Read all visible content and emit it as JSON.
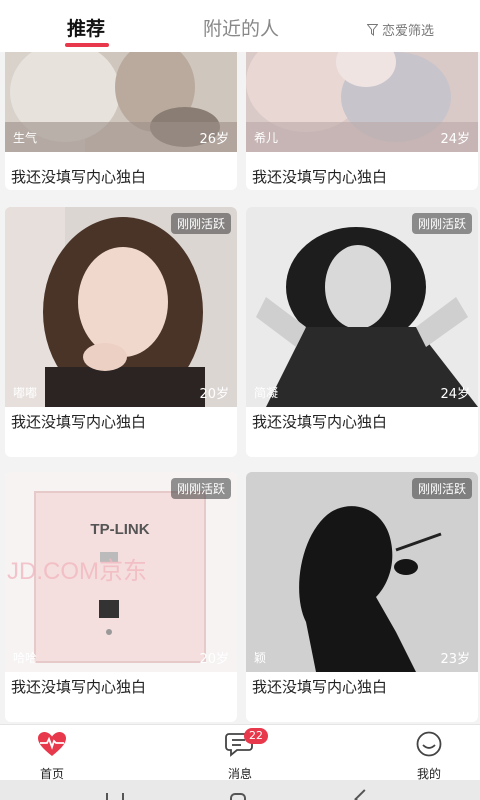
{
  "tabs": [
    {
      "label": "推荐",
      "active": true
    },
    {
      "label": "附近的人",
      "active": false
    }
  ],
  "filter": {
    "label": "恋爱筛选",
    "icon": "filter-icon"
  },
  "cards": [
    {
      "nickname": "生气",
      "age": "26岁",
      "badge": "",
      "bio": "我还没填写内心独白"
    },
    {
      "nickname": "希儿",
      "age": "24岁",
      "badge": "",
      "bio": "我还没填写内心独白"
    },
    {
      "nickname": "嘟嘟",
      "age": "20岁",
      "badge": "刚刚活跃",
      "bio": "我还没填写内心独白"
    },
    {
      "nickname": "简凝",
      "age": "24岁",
      "badge": "刚刚活跃",
      "bio": "我还没填写内心独白"
    },
    {
      "nickname": "哈哈",
      "age": "20岁",
      "badge": "刚刚活跃",
      "bio": "我还没填写内心独白",
      "photo_text": [
        "TP-LINK",
        "JD.COM京东"
      ]
    },
    {
      "nickname": "颖",
      "age": "23岁",
      "badge": "刚刚活跃",
      "bio": "我还没填写内心独白"
    }
  ],
  "bottom_nav": [
    {
      "label": "首页",
      "icon": "heart-pulse-icon",
      "active": true
    },
    {
      "label": "消息",
      "icon": "chat-bubble-icon",
      "badge": "22"
    },
    {
      "label": "我的",
      "icon": "smiley-icon"
    }
  ],
  "colors": {
    "accent": "#e8384b",
    "background": "#f3f3f3",
    "card": "#ffffff"
  }
}
